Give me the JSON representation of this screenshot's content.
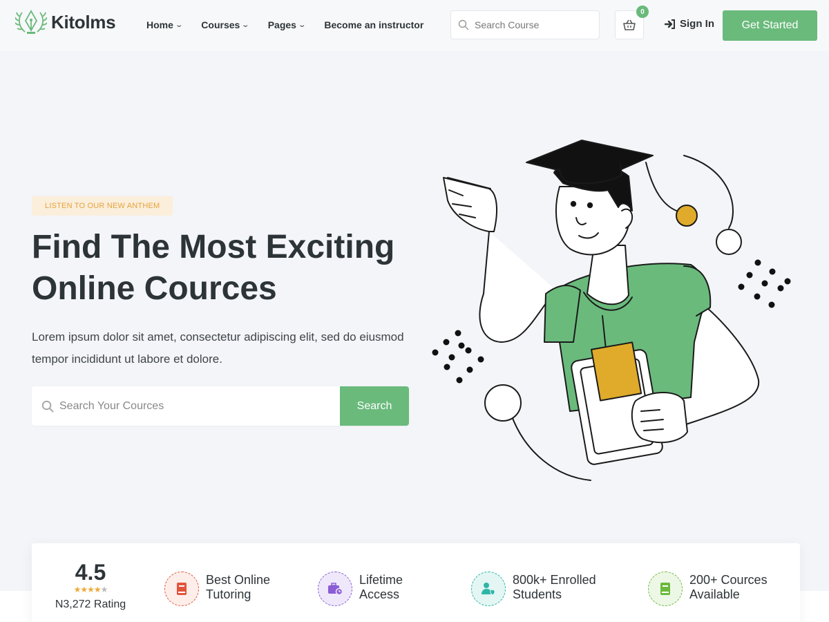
{
  "header": {
    "brand": "Kitolms",
    "nav": [
      {
        "label": "Home",
        "has_dropdown": true
      },
      {
        "label": "Courses",
        "has_dropdown": true
      },
      {
        "label": "Pages",
        "has_dropdown": true
      },
      {
        "label": "Become an instructor",
        "has_dropdown": false
      }
    ],
    "search_placeholder": "Search Course",
    "cart_count": "0",
    "sign_in_label": "Sign In",
    "cta_label": "Get Started"
  },
  "hero": {
    "tag": "LISTEN TO OUR NEW ANTHEM",
    "title_line1": "Find The Most Exciting",
    "title_line2": "Online Cources",
    "description": "Lorem ipsum dolor sit amet, consectetur adipiscing elit, sed do eiusmod tempor incididunt ut labore et dolore.",
    "search_placeholder": "Search Your Cources",
    "search_button": "Search"
  },
  "stats": {
    "rating_value": "4.5",
    "rating_stars": 4.5,
    "rating_count": "N3,272 Rating",
    "features": [
      {
        "line1": "Best Online",
        "line2": "Tutoring",
        "icon": "book-icon",
        "color": "#e2553d"
      },
      {
        "line1": "Lifetime",
        "line2": "Access",
        "icon": "briefcase-clock-icon",
        "color": "#8a5cd6"
      },
      {
        "line1": "800k+ Enrolled",
        "line2": "Students",
        "icon": "user-shield-icon",
        "color": "#2fb5a8"
      },
      {
        "line1": "200+ Cources",
        "line2": "Available",
        "icon": "book-icon",
        "color": "#6aba3c"
      }
    ]
  },
  "colors": {
    "accent": "#6aba7c",
    "tag_text": "#e6a23c",
    "tag_bg": "#fbeedb",
    "text_dark": "#2d3438",
    "page_bg": "#f3f5f8"
  }
}
